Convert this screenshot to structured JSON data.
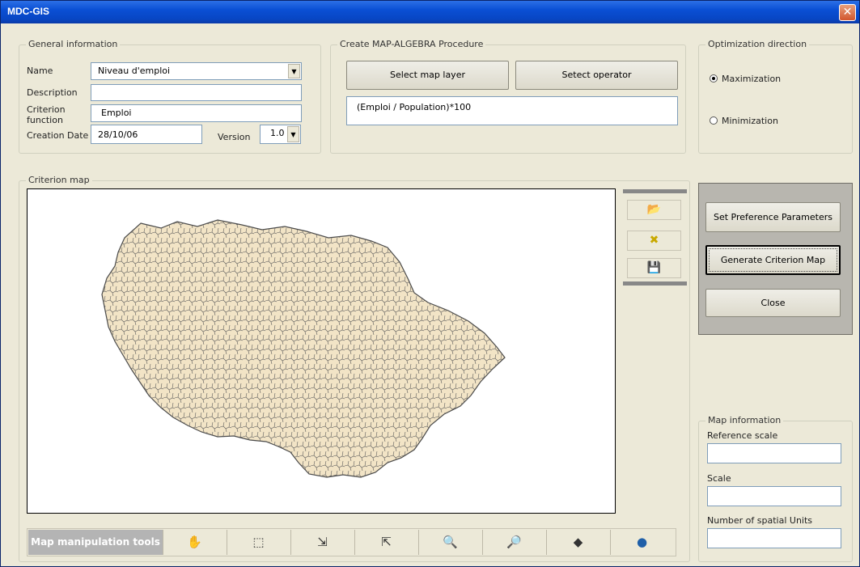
{
  "window": {
    "title": "MDC-GIS",
    "close_symbol": "✕"
  },
  "general": {
    "legend": "General information",
    "name_label": "Name",
    "name_value": "Niveau d'emploi",
    "description_label": "Description",
    "description_value": "",
    "criterion_label_1": "Criterion",
    "criterion_label_2": "function",
    "criterion_value": "Emploi",
    "date_label": "Creation Date",
    "date_value": "28/10/06",
    "version_label": "Version",
    "version_value": "1.0"
  },
  "algebra": {
    "legend": "Create MAP-ALGEBRA Procedure",
    "select_layer_label": "Select map layer",
    "select_operator_label": "Setect operator",
    "expression": "(Emploi  / Population)*100"
  },
  "optimization": {
    "legend": "Optimization direction",
    "options": [
      {
        "label": "Maximization",
        "selected": true
      },
      {
        "label": "Minimization",
        "selected": false
      }
    ]
  },
  "criterion_map": {
    "legend": "Criterion map",
    "fill_color": "#f2e4c6",
    "stroke_color": "#4a4a4a"
  },
  "side_tools": [
    {
      "icon": "open-folder-icon",
      "glyph": "📂"
    },
    {
      "icon": "delete-icon",
      "glyph": "✖"
    },
    {
      "icon": "save-icon",
      "glyph": "💾"
    }
  ],
  "actions": {
    "set_pref_label": "Set Preference Parameters",
    "generate_label": "Generate Criterion Map",
    "close_label": "Close"
  },
  "map_info": {
    "legend": "Map information",
    "ref_scale_label": "Reference scale",
    "ref_scale_value": "",
    "scale_label": "Scale",
    "scale_value": "",
    "units_label": "Number of spatial Units",
    "units_value": ""
  },
  "toolbar": {
    "label": "Map manipulation tools",
    "tools": [
      {
        "icon": "pan-hand-icon",
        "glyph": "✋"
      },
      {
        "icon": "select-area-icon",
        "glyph": "⬚"
      },
      {
        "icon": "zoom-in-arrows-icon",
        "glyph": "⇲"
      },
      {
        "icon": "zoom-out-arrows-icon",
        "glyph": "⇱"
      },
      {
        "icon": "zoom-out-icon",
        "glyph": "🔍"
      },
      {
        "icon": "zoom-in-icon",
        "glyph": "🔎"
      },
      {
        "icon": "identify-icon",
        "glyph": "◆"
      },
      {
        "icon": "globe-icon",
        "glyph": "●"
      }
    ]
  }
}
